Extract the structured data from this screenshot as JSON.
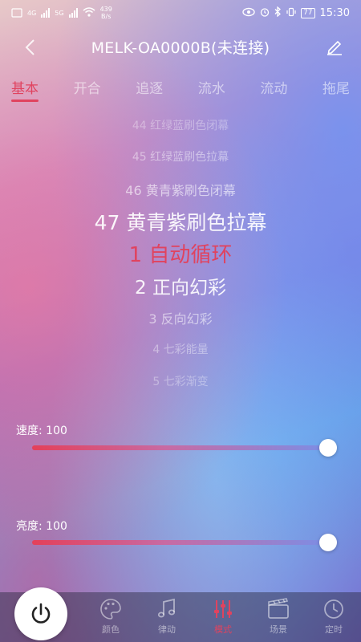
{
  "status_bar": {
    "net_speed_value": "439",
    "net_speed_unit": "B/s",
    "signal_1": "4G",
    "signal_2": "5G",
    "battery": "77",
    "time": "15:30"
  },
  "header": {
    "title": "MELK-OA0000B(未连接)"
  },
  "tabs": [
    {
      "label": "基本",
      "active": true
    },
    {
      "label": "开合",
      "active": false
    },
    {
      "label": "追逐",
      "active": false
    },
    {
      "label": "流水",
      "active": false
    },
    {
      "label": "流动",
      "active": false
    },
    {
      "label": "拖尾",
      "active": false
    }
  ],
  "modes": [
    {
      "label": "44 红绿蓝刷色闭幕"
    },
    {
      "label": "45 红绿蓝刷色拉幕"
    },
    {
      "label": "46 黄青紫刷色闭幕"
    },
    {
      "label": "47 黄青紫刷色拉幕"
    },
    {
      "label": "1 自动循环",
      "selected": true
    },
    {
      "label": "2 正向幻彩"
    },
    {
      "label": "3 反向幻彩"
    },
    {
      "label": "4 七彩能量"
    },
    {
      "label": "5 七彩渐变"
    }
  ],
  "speed": {
    "label": "速度: 100",
    "value": 100
  },
  "brightness": {
    "label": "亮度: 100",
    "value": 100
  },
  "bottom_nav": [
    {
      "label": "颜色",
      "icon": "palette-icon"
    },
    {
      "label": "律动",
      "icon": "music-note-icon"
    },
    {
      "label": "模式",
      "icon": "equalizer-icon",
      "active": true
    },
    {
      "label": "场景",
      "icon": "clapperboard-icon"
    },
    {
      "label": "定时",
      "icon": "clock-icon"
    }
  ],
  "colors": {
    "accent": "#e0435f",
    "selected_mode": "#e0435f"
  }
}
